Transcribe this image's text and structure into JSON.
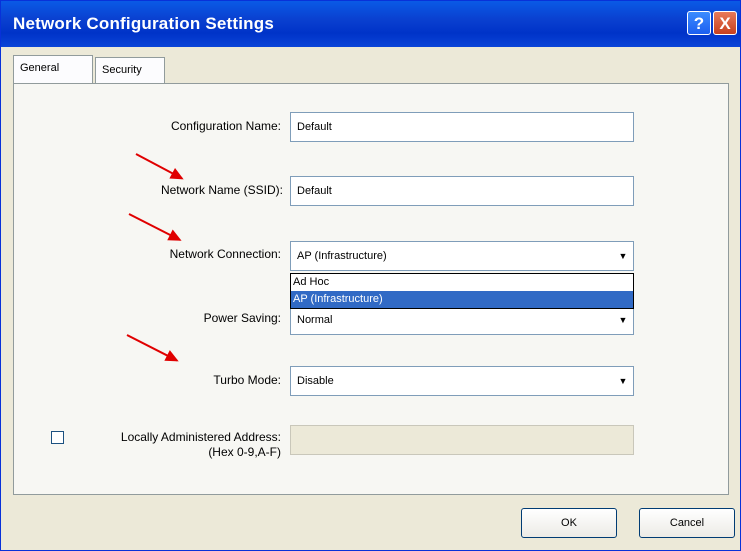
{
  "window": {
    "title": "Network Configuration Settings",
    "help_glyph": "?",
    "close_glyph": "X"
  },
  "tabs": [
    {
      "label": "General",
      "active": true
    },
    {
      "label": "Security",
      "active": false
    }
  ],
  "form": {
    "configuration_name": {
      "label": "Configuration Name:",
      "value": "Default"
    },
    "network_name": {
      "label": "Network Name (SSID):",
      "value": "Default"
    },
    "network_connection": {
      "label": "Network Connection:",
      "value": "AP (Infrastructure)",
      "options": [
        "Ad Hoc",
        "AP (Infrastructure)"
      ],
      "highlighted": "AP (Infrastructure)"
    },
    "power_saving": {
      "label": "Power Saving:",
      "value": "Normal"
    },
    "turbo_mode": {
      "label": "Turbo Mode:",
      "value": "Disable"
    },
    "laa": {
      "label_line1": "Locally Administered Address:",
      "label_line2": "(Hex 0-9,A-F)",
      "checked": false,
      "value": ""
    }
  },
  "buttons": {
    "ok": "OK",
    "cancel": "Cancel"
  },
  "annotation_color": "#e00000",
  "icons": {
    "dropdown": "chevron-down-icon",
    "annotation": "red-arrow-icon"
  }
}
